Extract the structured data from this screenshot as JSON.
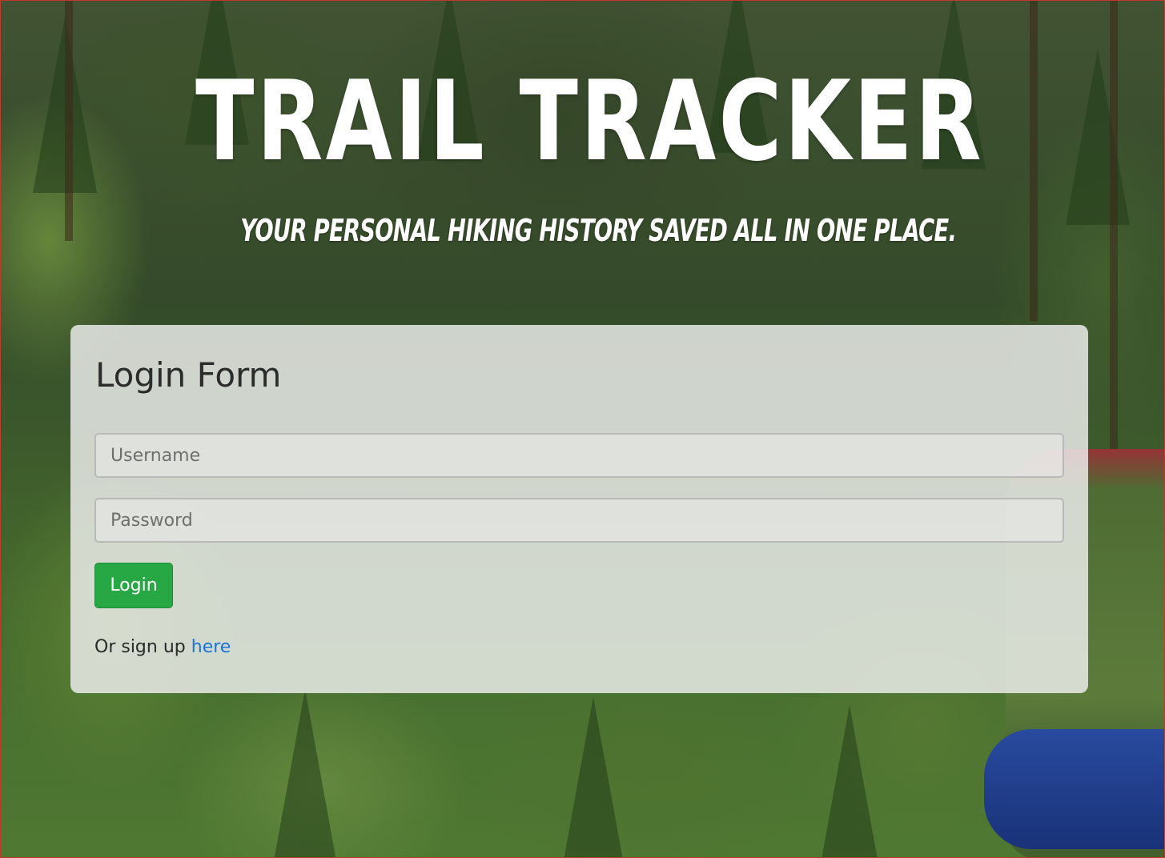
{
  "hero": {
    "title": "TRAIL TRACKER",
    "subtitle": "YOUR PERSONAL HIKING HISTORY SAVED ALL IN ONE PLACE."
  },
  "login_form": {
    "heading": "Login Form",
    "username_placeholder": "Username",
    "password_placeholder": "Password",
    "submit_label": "Login",
    "signup_prefix": "Or sign up",
    "signup_link": "here"
  },
  "colors": {
    "button_green": "#28a745",
    "link_blue": "#1a73d9",
    "title_text": "#ffffff"
  }
}
